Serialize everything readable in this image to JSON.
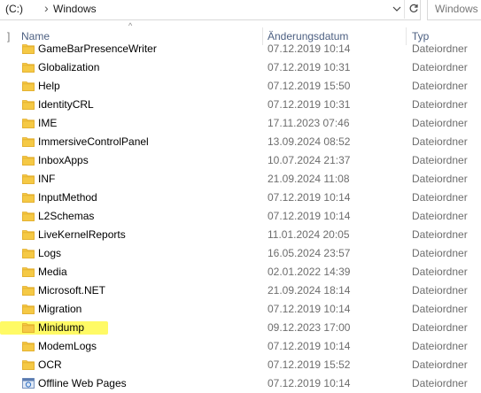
{
  "address_bar": {
    "drive_label": "(C:)",
    "separator": "›",
    "folder": "Windows",
    "dropdown_icon": "chevron-down-icon",
    "refresh_icon": "refresh-icon"
  },
  "search": {
    "placeholder": "Windows"
  },
  "columns": {
    "lead_mark": "]",
    "name": "Name",
    "date": "Änderungsdatum",
    "type": "Typ",
    "sort_indicator": "^"
  },
  "rows": [
    {
      "name": "GameBarPresenceWriter",
      "date": "07.12.2019 10:14",
      "type": "Dateiordner",
      "icon": "folder-icon"
    },
    {
      "name": "Globalization",
      "date": "07.12.2019 10:31",
      "type": "Dateiordner",
      "icon": "folder-icon"
    },
    {
      "name": "Help",
      "date": "07.12.2019 15:50",
      "type": "Dateiordner",
      "icon": "folder-icon"
    },
    {
      "name": "IdentityCRL",
      "date": "07.12.2019 10:31",
      "type": "Dateiordner",
      "icon": "folder-icon"
    },
    {
      "name": "IME",
      "date": "17.11.2023 07:46",
      "type": "Dateiordner",
      "icon": "folder-icon"
    },
    {
      "name": "ImmersiveControlPanel",
      "date": "13.09.2024 08:52",
      "type": "Dateiordner",
      "icon": "folder-icon"
    },
    {
      "name": "InboxApps",
      "date": "10.07.2024 21:37",
      "type": "Dateiordner",
      "icon": "folder-icon"
    },
    {
      "name": "INF",
      "date": "21.09.2024 11:08",
      "type": "Dateiordner",
      "icon": "folder-icon"
    },
    {
      "name": "InputMethod",
      "date": "07.12.2019 10:14",
      "type": "Dateiordner",
      "icon": "folder-icon"
    },
    {
      "name": "L2Schemas",
      "date": "07.12.2019 10:14",
      "type": "Dateiordner",
      "icon": "folder-icon"
    },
    {
      "name": "LiveKernelReports",
      "date": "11.01.2024 20:05",
      "type": "Dateiordner",
      "icon": "folder-icon"
    },
    {
      "name": "Logs",
      "date": "16.05.2024 23:57",
      "type": "Dateiordner",
      "icon": "folder-icon"
    },
    {
      "name": "Media",
      "date": "02.01.2022 14:39",
      "type": "Dateiordner",
      "icon": "folder-icon"
    },
    {
      "name": "Microsoft.NET",
      "date": "21.09.2024 18:14",
      "type": "Dateiordner",
      "icon": "folder-icon"
    },
    {
      "name": "Migration",
      "date": "07.12.2019 10:14",
      "type": "Dateiordner",
      "icon": "folder-icon"
    },
    {
      "name": "Minidump",
      "date": "09.12.2023 17:00",
      "type": "Dateiordner",
      "icon": "folder-icon",
      "highlighted": true,
      "highlight_color": "#fff94a"
    },
    {
      "name": "ModemLogs",
      "date": "07.12.2019 10:14",
      "type": "Dateiordner",
      "icon": "folder-icon"
    },
    {
      "name": "OCR",
      "date": "07.12.2019 15:52",
      "type": "Dateiordner",
      "icon": "folder-icon"
    },
    {
      "name": "Offline Web Pages",
      "date": "07.12.2019 10:14",
      "type": "Dateiordner",
      "icon": "special-folder-icon"
    }
  ],
  "colors": {
    "folder": "#f5c945",
    "folder_dark": "#e2ad2b",
    "header_text": "#4d6082",
    "secondary_text": "#6d6d6d",
    "highlight": "#fff94a"
  }
}
